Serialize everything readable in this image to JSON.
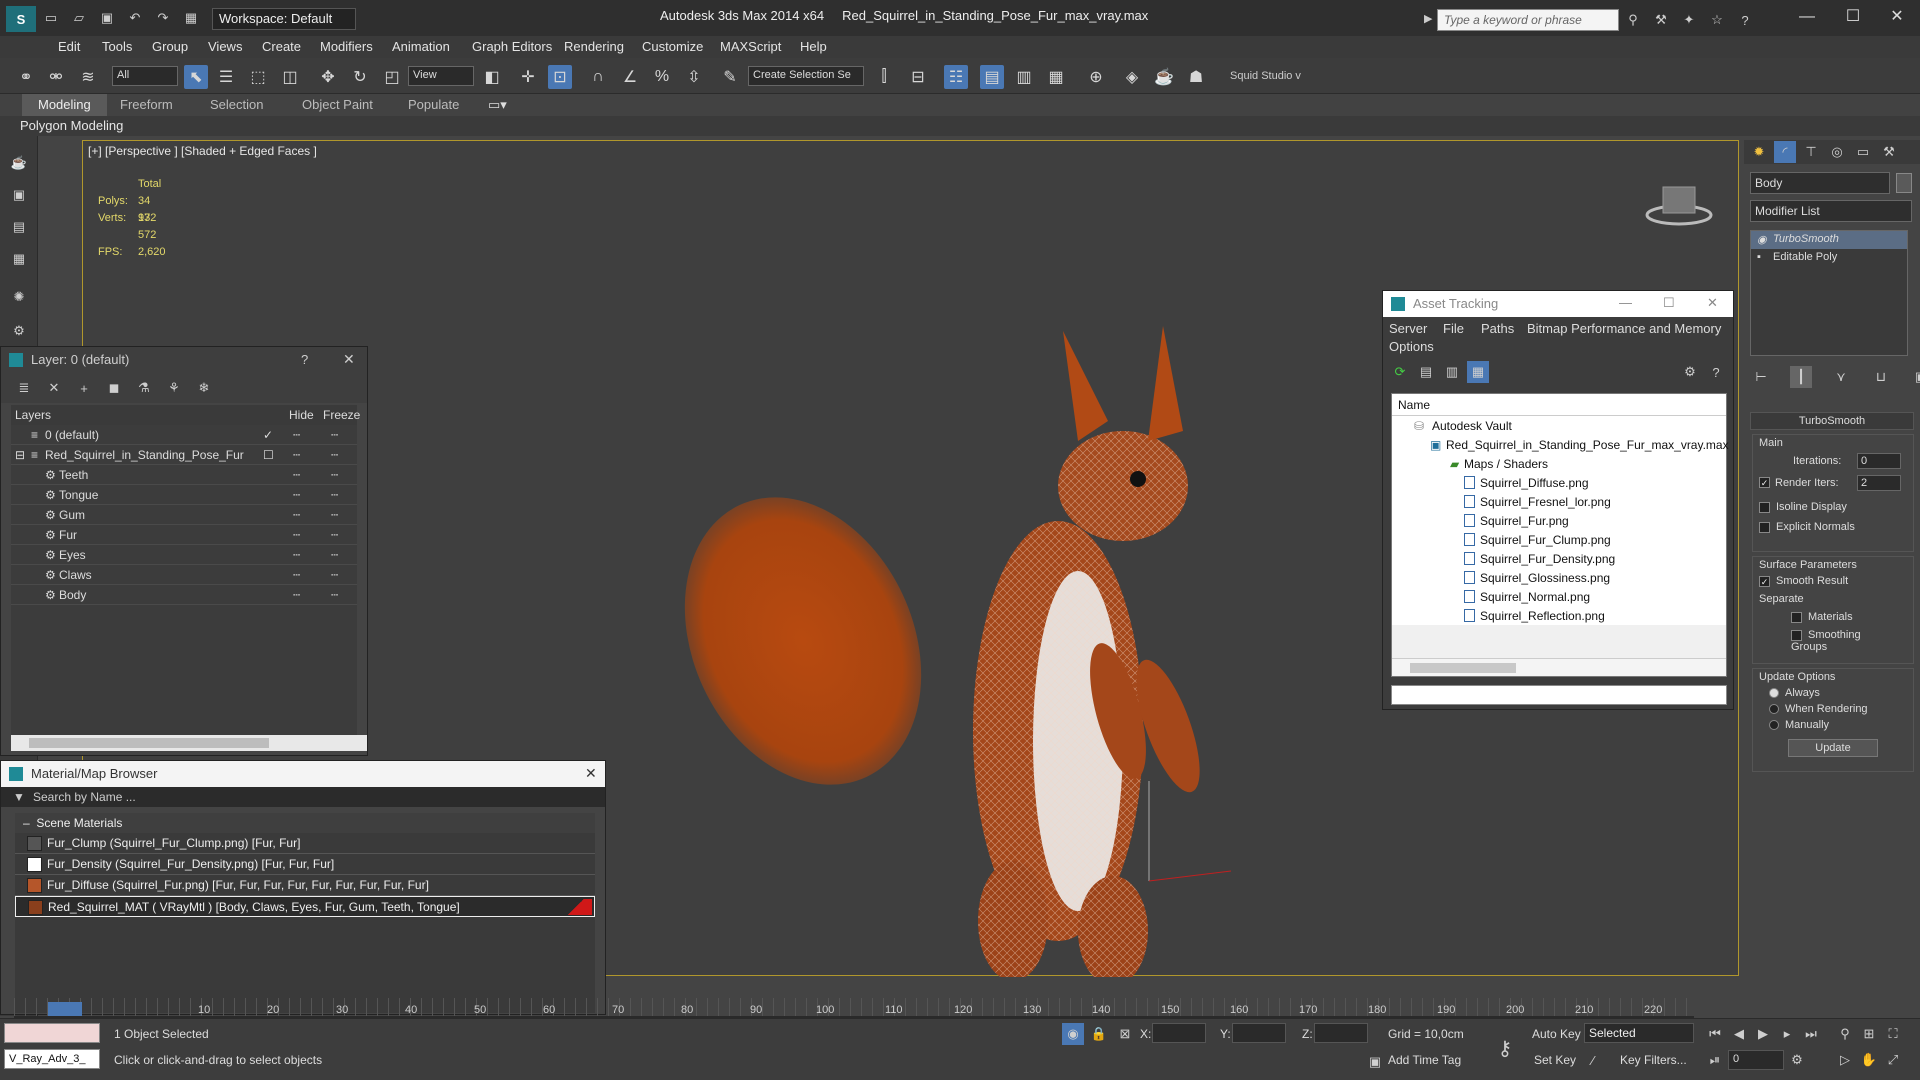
{
  "app": {
    "title": "Autodesk 3ds Max  2014 x64",
    "file": "Red_Squirrel_in_Standing_Pose_Fur_max_vray.max",
    "workspace": "Workspace: Default",
    "search_placeholder": "Type a keyword or phrase"
  },
  "menu": [
    "Edit",
    "Tools",
    "Group",
    "Views",
    "Create",
    "Modifiers",
    "Animation",
    "Graph Editors",
    "Rendering",
    "Customize",
    "MAXScript",
    "Help"
  ],
  "toolbar": {
    "filter": "All",
    "ref_coord": "View",
    "selection_set": "Create Selection Se",
    "studio": "Squid Studio v"
  },
  "ribbon": {
    "tabs": [
      "Modeling",
      "Freeform",
      "Selection",
      "Object Paint",
      "Populate"
    ],
    "active_tab": "Modeling",
    "sub": "Polygon Modeling"
  },
  "viewport": {
    "label": "[+] [Perspective ] [Shaded + Edged Faces ]",
    "stats": {
      "total_label": "Total",
      "polys_label": "Polys:",
      "polys": "34 932",
      "verts_label": "Verts:",
      "verts": "17 572",
      "fps_label": "FPS:",
      "fps": "2,620"
    }
  },
  "layer_panel": {
    "title": "Layer: 0 (default)",
    "help": "?",
    "col_layers": "Layers",
    "col_hide": "Hide",
    "col_freeze": "Freeze",
    "rows": [
      {
        "name": "0 (default)"
      },
      {
        "name": "Red_Squirrel_in_Standing_Pose_Fur"
      },
      {
        "name": "Teeth"
      },
      {
        "name": "Tongue"
      },
      {
        "name": "Gum"
      },
      {
        "name": "Fur"
      },
      {
        "name": "Eyes"
      },
      {
        "name": "Claws"
      },
      {
        "name": "Body"
      }
    ]
  },
  "material_browser": {
    "title": "Material/Map Browser",
    "search": "Search by Name ...",
    "section": "Scene Materials",
    "items": [
      "Fur_Clump (Squirrel_Fur_Clump.png)  [Fur, Fur]",
      "Fur_Density (Squirrel_Fur_Density.png)  [Fur, Fur, Fur]",
      "Fur_Diffuse (Squirrel_Fur.png)  [Fur, Fur, Fur, Fur, Fur, Fur, Fur, Fur, Fur]",
      "Red_Squirrel_MAT  ( VRayMtl )  [Body, Claws, Eyes, Fur, Gum, Teeth, Tongue]"
    ]
  },
  "asset_tracking": {
    "title": "Asset Tracking",
    "menu": [
      "Server",
      "File",
      "Paths",
      "Bitmap Performance and Memory",
      "Options"
    ],
    "col_name": "Name",
    "vault": "Autodesk Vault",
    "file": "Red_Squirrel_in_Standing_Pose_Fur_max_vray.max",
    "folder": "Maps / Shaders",
    "maps": [
      "Squirrel_Diffuse.png",
      "Squirrel_Fresnel_lor.png",
      "Squirrel_Fur.png",
      "Squirrel_Fur_Clump.png",
      "Squirrel_Fur_Density.png",
      "Squirrel_Glossiness.png",
      "Squirrel_Normal.png",
      "Squirrel_Reflection.png"
    ]
  },
  "command_panel": {
    "object_name": "Body",
    "modifier_list": "Modifier List",
    "stack": [
      "TurboSmooth",
      "Editable Poly"
    ],
    "rollout": "TurboSmooth",
    "main": "Main",
    "iterations_label": "Iterations:",
    "iterations": "0",
    "render_iters_label": "Render Iters:",
    "render_iters": "2",
    "isoline": "Isoline Display",
    "explicit": "Explicit Normals",
    "surface": "Surface Parameters",
    "smooth": "Smooth Result",
    "separate": "Separate",
    "materials": "Materials",
    "smoothing_groups": "Smoothing Groups",
    "update_options": "Update Options",
    "always": "Always",
    "when_rendering": "When Rendering",
    "manually": "Manually",
    "update_btn": "Update"
  },
  "timeline": {
    "ticks": [
      "10",
      "20",
      "30",
      "40",
      "50",
      "60",
      "70",
      "80",
      "90",
      "100",
      "110",
      "120",
      "130",
      "140",
      "150",
      "160",
      "170",
      "180",
      "190",
      "200",
      "210",
      "220"
    ]
  },
  "status": {
    "script": "V_Ray_Adv_3_",
    "selected": "1 Object Selected",
    "prompt": "Click or click-and-drag to select objects",
    "x": "X:",
    "y": "Y:",
    "z": "Z:",
    "grid": "Grid = 10,0cm",
    "add_time_tag": "Add Time Tag",
    "auto_key": "Auto Key",
    "set_key": "Set Key",
    "selected_dropdown": "Selected",
    "key_filters": "Key Filters...",
    "frame": "0"
  }
}
